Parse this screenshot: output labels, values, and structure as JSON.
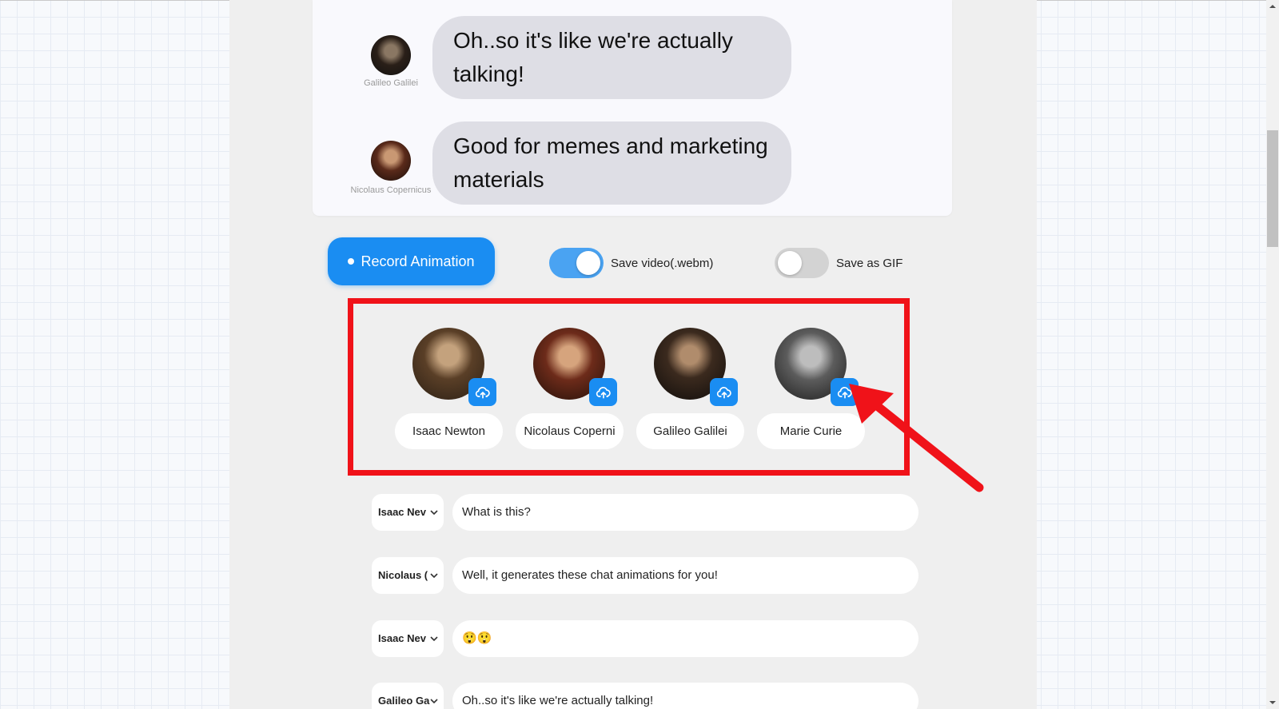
{
  "preview": {
    "messages": [
      {
        "name": "Galileo Galilei",
        "text": "Oh..so it's like we're actually talking!",
        "avatar_color": "#3a2a1f"
      },
      {
        "name": "Nicolaus Copernicus",
        "text": "Good for memes and marketing materials",
        "avatar_color": "#4a2418"
      }
    ]
  },
  "controls": {
    "record_label": "Record Animation",
    "save_video": {
      "label": "Save video(.webm)",
      "on": true
    },
    "save_gif": {
      "label": "Save as GIF",
      "on": false
    }
  },
  "characters": [
    {
      "name": "Isaac Newton",
      "portrait_icon": "isaac-newton-portrait",
      "upload_icon": "cloud-upload-icon"
    },
    {
      "name": "Nicolaus Coperni",
      "portrait_icon": "nicolaus-copernicus-portrait",
      "upload_icon": "cloud-upload-icon"
    },
    {
      "name": "Galileo Galilei",
      "portrait_icon": "galileo-galilei-portrait",
      "upload_icon": "cloud-upload-icon"
    },
    {
      "name": "Marie Curie",
      "portrait_icon": "marie-curie-portrait",
      "upload_icon": "cloud-upload-icon"
    }
  ],
  "dialogue": [
    {
      "speaker": "Isaac Nev",
      "text": "What is this?"
    },
    {
      "speaker": "Nicolaus (",
      "text": "Well, it generates these chat animations for you!"
    },
    {
      "speaker": "Isaac Nev",
      "text": "😲😲"
    },
    {
      "speaker": "Galileo Ga",
      "text": "Oh..so it's like we're actually talking!"
    }
  ],
  "colors": {
    "accent": "#1a8df2",
    "highlight_box": "#f01219",
    "arrow": "#f01219",
    "bubble": "#dedee5"
  }
}
